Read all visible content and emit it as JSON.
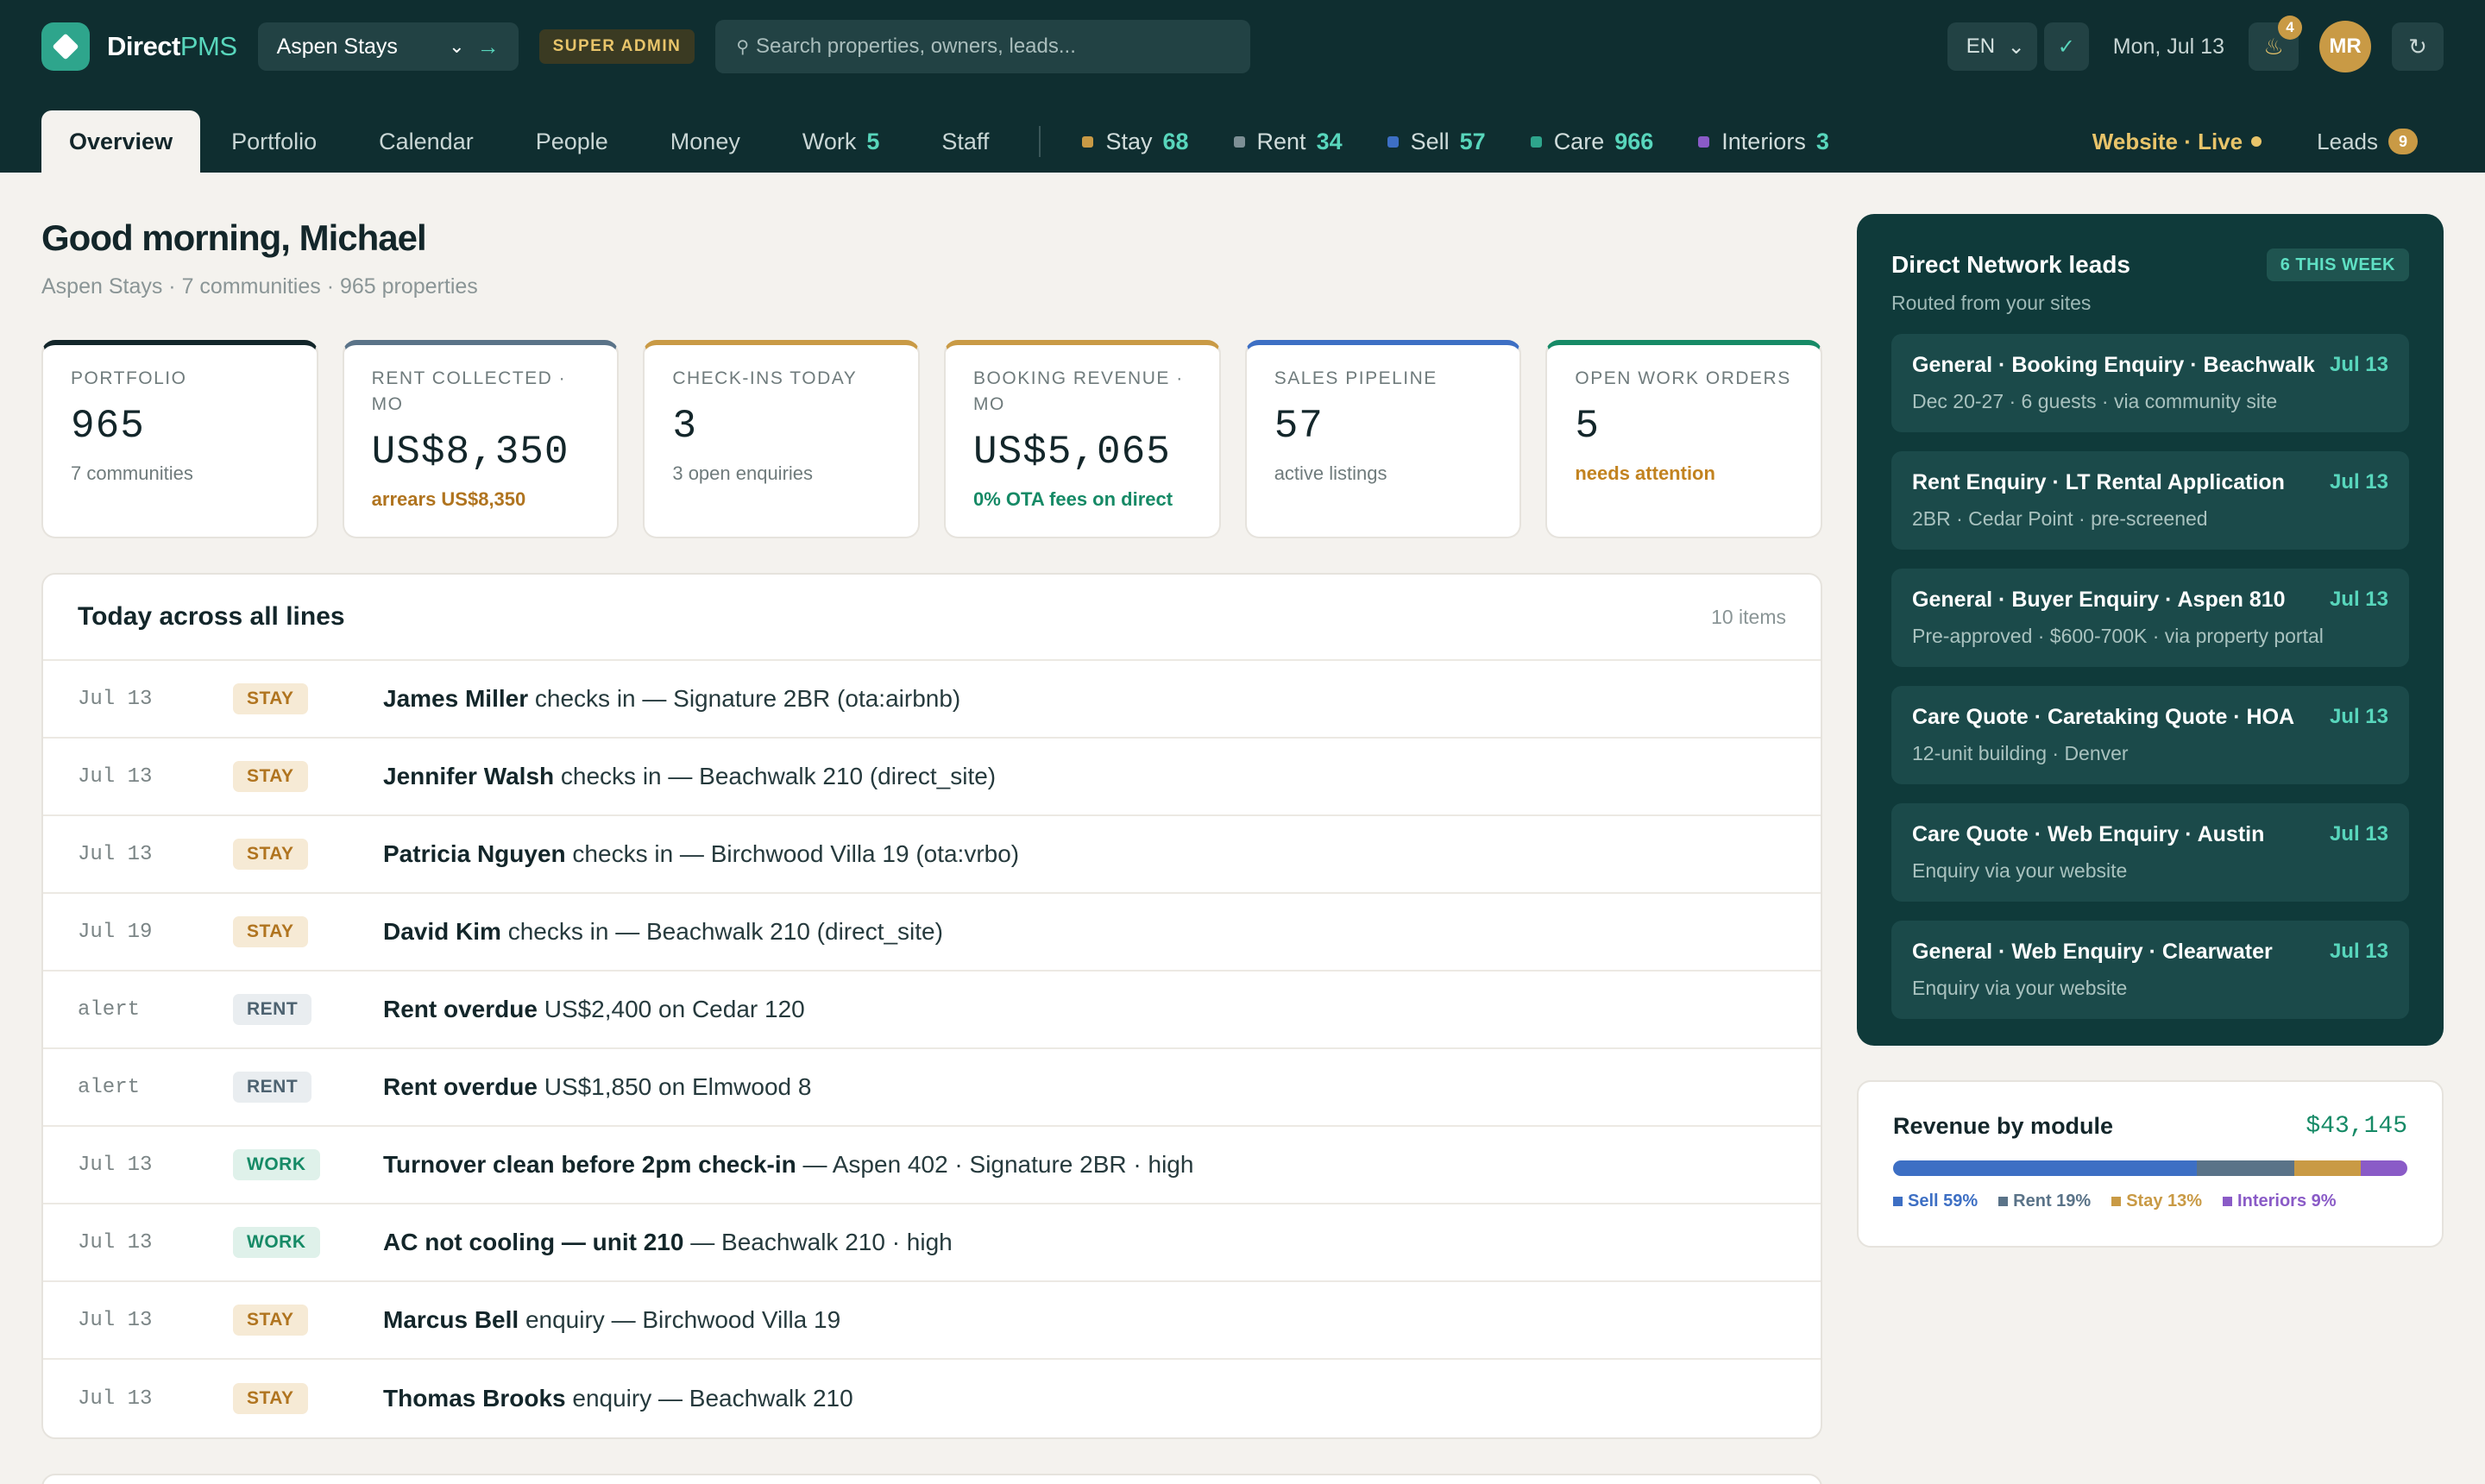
{
  "brand": {
    "part1": "Direct",
    "part2": "PMS"
  },
  "org_select": {
    "value": "Aspen Stays"
  },
  "role_badge": "SUPER ADMIN",
  "search": {
    "placeholder": "Search properties, owners, leads..."
  },
  "lang": "EN",
  "date": "Mon, Jul 13",
  "notifications": {
    "count": "4"
  },
  "avatar": "MR",
  "tabs": [
    {
      "label": "Overview",
      "active": true
    },
    {
      "label": "Portfolio"
    },
    {
      "label": "Calendar"
    },
    {
      "label": "People"
    },
    {
      "label": "Money"
    },
    {
      "label": "Work",
      "num": "5"
    },
    {
      "label": "Staff"
    }
  ],
  "modules": [
    {
      "label": "Stay",
      "num": "68",
      "color": "#c99a45"
    },
    {
      "label": "Rent",
      "num": "34",
      "color": "#7d8f95"
    },
    {
      "label": "Sell",
      "num": "57",
      "color": "#3d6fc4"
    },
    {
      "label": "Care",
      "num": "966",
      "color": "#2ea58c"
    },
    {
      "label": "Interiors",
      "num": "3",
      "color": "#8a5bc7"
    }
  ],
  "website": {
    "label": "Website · Live"
  },
  "leads_nav": {
    "label": "Leads",
    "count": "9"
  },
  "greeting": "Good morning, Michael",
  "subtitle": "Aspen Stays · 7 communities · 965 properties",
  "kpis": [
    {
      "label": "PORTFOLIO",
      "value": "965",
      "hint": "7 communities",
      "accent": "#13262a",
      "hint_style": ""
    },
    {
      "label": "RENT COLLECTED · MO",
      "value": "US$8,350",
      "hint": "arrears US$8,350",
      "accent": "#5a7388",
      "hint_style": "warn"
    },
    {
      "label": "CHECK-INS TODAY",
      "value": "3",
      "hint": "3 open enquiries",
      "accent": "#c99a45",
      "hint_style": ""
    },
    {
      "label": "BOOKING REVENUE · MO",
      "value": "US$5,065",
      "hint": "0% OTA fees on direct",
      "accent": "#c99a45",
      "hint_style": "good"
    },
    {
      "label": "SALES PIPELINE",
      "value": "57",
      "hint": "active listings",
      "accent": "#3d6fc4",
      "hint_style": ""
    },
    {
      "label": "OPEN WORK ORDERS",
      "value": "5",
      "hint": "needs attention",
      "accent": "#168a66",
      "hint_style": "gold"
    }
  ],
  "today": {
    "title": "Today across all lines",
    "count": "10 items",
    "rows": [
      {
        "date": "Jul 13",
        "tag": "STAY",
        "bold": "James Miller",
        "rest": " checks in — Signature 2BR (ota:airbnb)"
      },
      {
        "date": "Jul 13",
        "tag": "STAY",
        "bold": "Jennifer Walsh",
        "rest": " checks in — Beachwalk 210 (direct_site)"
      },
      {
        "date": "Jul 13",
        "tag": "STAY",
        "bold": "Patricia Nguyen",
        "rest": " checks in — Birchwood Villa 19 (ota:vrbo)"
      },
      {
        "date": "Jul 19",
        "tag": "STAY",
        "bold": "David Kim",
        "rest": " checks in — Beachwalk 210 (direct_site)"
      },
      {
        "date": "alert",
        "tag": "RENT",
        "bold": "Rent overdue",
        "rest": " US$2,400 on Cedar 120"
      },
      {
        "date": "alert",
        "tag": "RENT",
        "bold": "Rent overdue",
        "rest": " US$1,850 on Elmwood 8"
      },
      {
        "date": "Jul 13",
        "tag": "WORK",
        "bold": "Turnover clean before 2pm check-in",
        "rest": " — Aspen 402 · Signature 2BR · high"
      },
      {
        "date": "Jul 13",
        "tag": "WORK",
        "bold": "AC not cooling — unit 210",
        "rest": " — Beachwalk 210 · high"
      },
      {
        "date": "Jul 13",
        "tag": "STAY",
        "bold": "Marcus Bell",
        "rest": " enquiry — Birchwood Villa 19"
      },
      {
        "date": "Jul 13",
        "tag": "STAY",
        "bold": "Thomas Brooks",
        "rest": " enquiry — Beachwalk 210"
      }
    ]
  },
  "leads_panel": {
    "title": "Direct Network leads",
    "badge": "6 THIS WEEK",
    "subtitle": "Routed from your sites",
    "items": [
      {
        "title": "General · Booking Enquiry · Beachwalk",
        "date": "Jul 13",
        "desc": "Dec 20-27 · 6 guests · via community site"
      },
      {
        "title": "Rent Enquiry · LT Rental Application",
        "date": "Jul 13",
        "desc": "2BR · Cedar Point · pre-screened"
      },
      {
        "title": "General · Buyer Enquiry · Aspen 810",
        "date": "Jul 13",
        "desc": "Pre-approved · $600-700K · via property portal"
      },
      {
        "title": "Care Quote · Caretaking Quote · HOA",
        "date": "Jul 13",
        "desc": "12-unit building · Denver"
      },
      {
        "title": "Care Quote · Web Enquiry · Austin",
        "date": "Jul 13",
        "desc": "Enquiry via your website"
      },
      {
        "title": "General · Web Enquiry · Clearwater",
        "date": "Jul 13",
        "desc": "Enquiry via your website"
      }
    ]
  },
  "revenue": {
    "title": "Revenue by module",
    "total": "$43,145",
    "segments": [
      {
        "label": "Sell 59%",
        "share": 59,
        "color": "#3d6fc4"
      },
      {
        "label": "Rent 19%",
        "share": 19,
        "color": "#5a7388"
      },
      {
        "label": "Stay 13%",
        "share": 13,
        "color": "#c99a45"
      },
      {
        "label": "Interiors 9%",
        "share": 9,
        "color": "#8a5bc7"
      }
    ]
  }
}
